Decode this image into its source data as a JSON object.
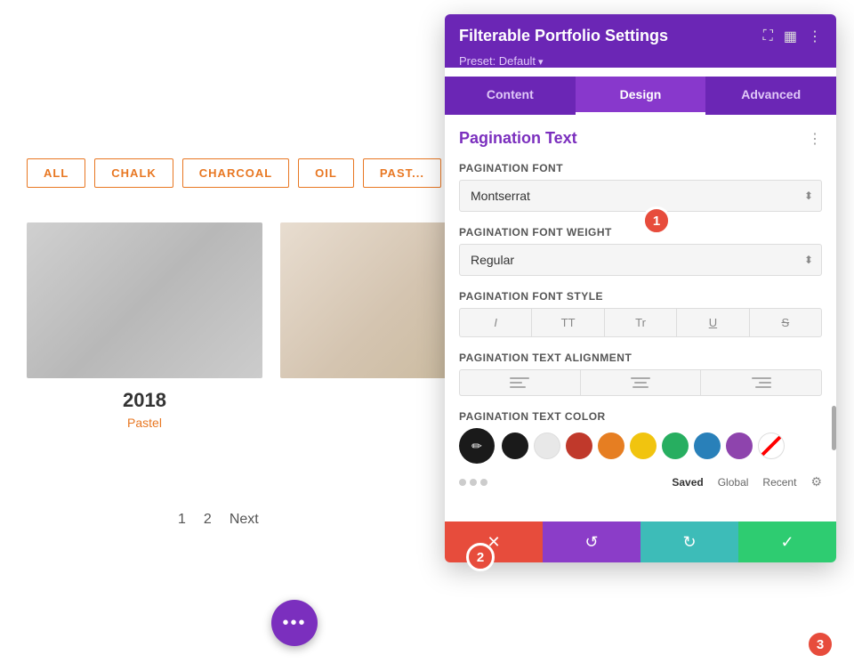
{
  "page": {
    "title": "Filterable Portfolio Settings"
  },
  "filter_tabs": {
    "items": [
      {
        "label": "ALL",
        "active": false
      },
      {
        "label": "CHALK",
        "active": false
      },
      {
        "label": "CHARCOAL",
        "active": false
      },
      {
        "label": "OIL",
        "active": false
      },
      {
        "label": "PAST...",
        "active": false
      }
    ]
  },
  "portfolio": {
    "item1": {
      "year": "2018",
      "category": "Pastel"
    }
  },
  "pagination": {
    "page1": "1",
    "page2": "2",
    "next": "Next"
  },
  "panel": {
    "title": "Filterable Portfolio Settings",
    "preset_label": "Preset: Default",
    "tabs": [
      {
        "label": "Content",
        "active": false
      },
      {
        "label": "Design",
        "active": true
      },
      {
        "label": "Advanced",
        "active": false
      }
    ],
    "section_title": "Pagination Text",
    "fields": {
      "font_label": "Pagination Font",
      "font_value": "Montserrat",
      "font_weight_label": "Pagination Font Weight",
      "font_weight_value": "Regular",
      "font_style_label": "Pagination Font Style",
      "style_buttons": [
        "I",
        "TT",
        "Tr",
        "U",
        "S"
      ],
      "alignment_label": "Pagination Text Alignment",
      "color_label": "Pagination Text Color"
    },
    "color_footer": {
      "saved": "Saved",
      "global": "Global",
      "recent": "Recent"
    },
    "footer_buttons": {
      "cancel_icon": "✕",
      "undo_icon": "↺",
      "redo_icon": "↻",
      "confirm_icon": "✓"
    }
  },
  "colors": {
    "black": "#1a1a1a",
    "white": "#ffffff",
    "red": "#c0392b",
    "orange": "#e67e22",
    "yellow": "#f1c40f",
    "green": "#27ae60",
    "blue": "#2980b9",
    "purple": "#8e44ad",
    "transparent": "transparent"
  },
  "badges": {
    "b1": "1",
    "b2": "2",
    "b3": "3"
  }
}
